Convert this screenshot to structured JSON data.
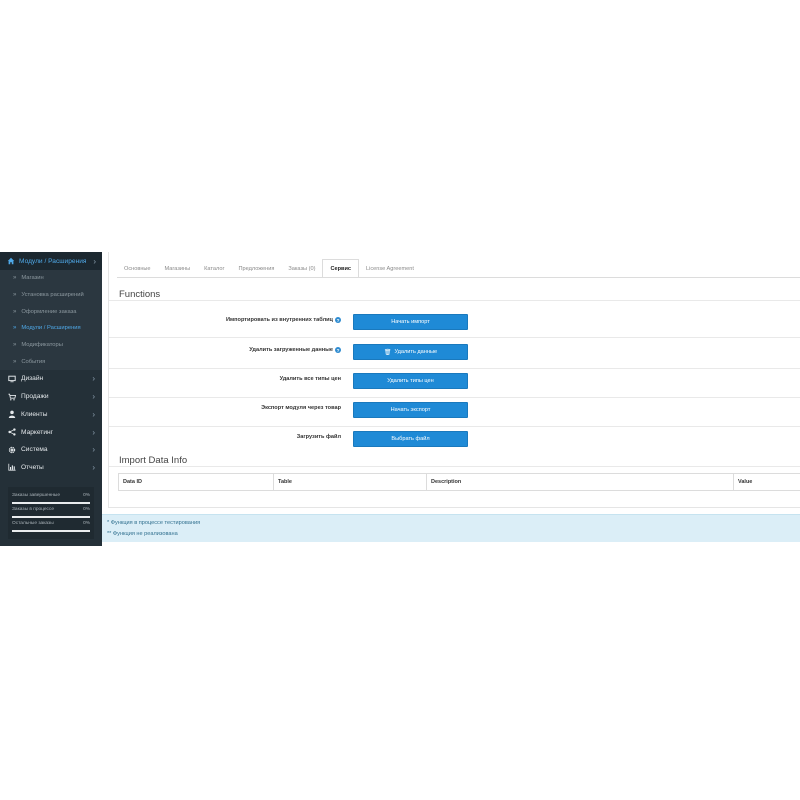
{
  "sidebar": {
    "active_section": "Модули / Расширения",
    "sub_items": [
      {
        "label": "Магазин",
        "active": false
      },
      {
        "label": "Установка расширений",
        "active": false
      },
      {
        "label": "Оформление заказа",
        "active": false
      },
      {
        "label": "Модули / Расширения",
        "active": true
      },
      {
        "label": "Модификаторы",
        "active": false
      },
      {
        "label": "События",
        "active": false
      }
    ],
    "main_items": [
      {
        "label": "Дизайн",
        "icon": "monitor-icon"
      },
      {
        "label": "Продажи",
        "icon": "cart-icon"
      },
      {
        "label": "Клиенты",
        "icon": "user-icon"
      },
      {
        "label": "Маркетинг",
        "icon": "share-icon"
      },
      {
        "label": "Система",
        "icon": "gear-icon"
      },
      {
        "label": "Отчеты",
        "icon": "bar-chart-icon"
      }
    ],
    "stats": [
      {
        "label": "Заказы завершенные",
        "value": "0%"
      },
      {
        "label": "Заказы в процессе",
        "value": "0%"
      },
      {
        "label": "Остальные заказы",
        "value": "0%"
      }
    ]
  },
  "tabs": [
    {
      "label": "Основные",
      "active": false
    },
    {
      "label": "Магазины",
      "active": false
    },
    {
      "label": "Каталог",
      "active": false
    },
    {
      "label": "Предложения",
      "active": false
    },
    {
      "label": "Заказы (0)",
      "active": false
    },
    {
      "label": "Сервис",
      "active": true
    },
    {
      "label": "License Agreement",
      "active": false
    }
  ],
  "functions": {
    "title": "Functions",
    "rows": [
      {
        "label": "Импортировать из внутренних таблиц",
        "help": true,
        "button": "Начать импорт",
        "button_icon": ""
      },
      {
        "label": "Удалить загруженные данные",
        "help": true,
        "button": "Удалить данные",
        "button_icon": "trash-icon"
      },
      {
        "label": "Удалить все типы цен",
        "help": false,
        "button": "Удалить типы цен",
        "button_icon": ""
      },
      {
        "label": "Экспорт модуля через товар",
        "help": false,
        "button": "Начать экспорт",
        "button_icon": ""
      },
      {
        "label": "Загрузить файл",
        "help": false,
        "button": "Выбрать файл",
        "button_icon": ""
      }
    ]
  },
  "import_info": {
    "title": "Import Data Info",
    "columns": [
      "Data ID",
      "Table",
      "Description",
      "Value"
    ]
  },
  "notes": [
    "* Функция в процессе тестирования",
    "** Функция не реализована"
  ],
  "colors": {
    "sidebar_bg": "#243038",
    "accent": "#1f8ad6",
    "notes_bg": "#dbeef7"
  }
}
